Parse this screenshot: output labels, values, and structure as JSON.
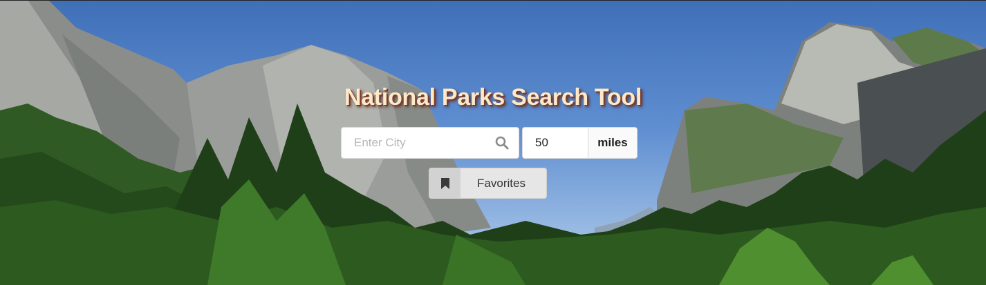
{
  "header": {
    "title": "National Parks Search Tool"
  },
  "search": {
    "city_placeholder": "Enter City",
    "city_value": "",
    "distance_value": "50",
    "distance_unit": "miles"
  },
  "favorites": {
    "label": "Favorites"
  },
  "icons": {
    "search": "search-icon",
    "favorites": "bookmark-icon"
  },
  "colors": {
    "title_text": "#fbe9c8",
    "title_shadow": "#7a3a2a",
    "button_bg": "#e6e6e6"
  }
}
